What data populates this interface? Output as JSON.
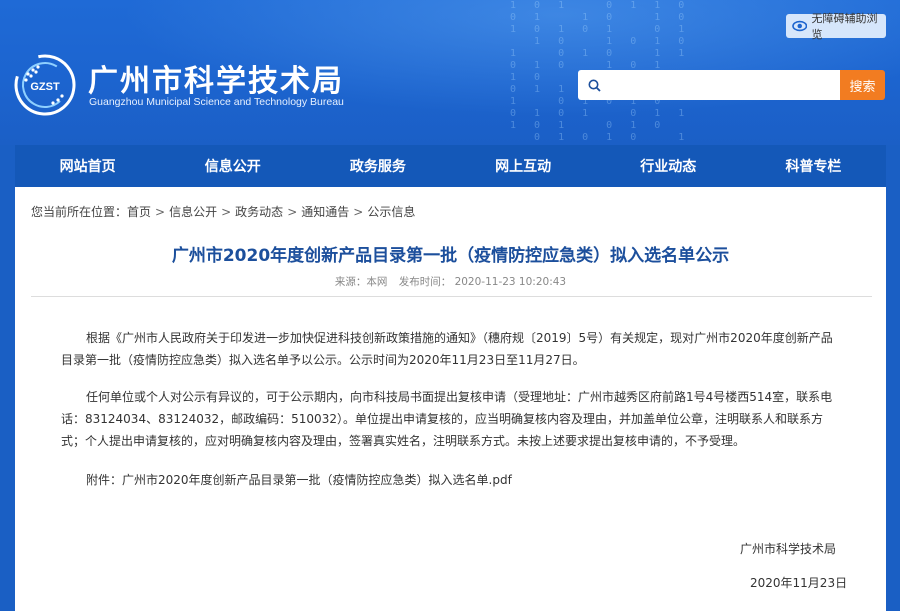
{
  "header": {
    "title": "广州市科学技术局",
    "subtitle": "Guangzhou Municipal Science and Technology Bureau",
    "logo_text": "GZST",
    "accessibility_label": "无障碍辅助浏览",
    "search_placeholder": "",
    "search_button": "搜索"
  },
  "nav": {
    "items": [
      {
        "label": "网站首页"
      },
      {
        "label": "信息公开"
      },
      {
        "label": "政务服务"
      },
      {
        "label": "网上互动"
      },
      {
        "label": "行业动态"
      },
      {
        "label": "科普专栏"
      }
    ]
  },
  "breadcrumb": {
    "prefix": "您当前所在位置：",
    "items": [
      "首页",
      "信息公开",
      "政务动态",
      "通知通告",
      "公示信息"
    ],
    "separator": ">"
  },
  "article": {
    "title": "广州市2020年度创新产品目录第一批（疫情防控应急类）拟入选名单公示",
    "source": "来源：本网",
    "time": "发布时间：  2020-11-23 10:20:43",
    "paragraphs": [
      "根据《广州市人民政府关于印发进一步加快促进科技创新政策措施的通知》（穗府规〔2019〕5号）有关规定，现对广州市2020年度创新产品目录第一批（疫情防控应急类）拟入选名单予以公示。公示时间为2020年11月23日至11月27日。",
      "任何单位或个人对公示有异议的，可于公示期内，向市科技局书面提出复核申请（受理地址：广州市越秀区府前路1号4号楼西514室，联系电话：83124034、83124032，邮政编码：510032）。单位提出申请复核的，应当明确复核内容及理由，并加盖单位公章，注明联系人和联系方式；个人提出申请复核的，应对明确复核内容及理由，签署真实姓名，注明联系方式。未按上述要求提出复核申请的，不予受理。",
      "附件：广州市2020年度创新产品目录第一批（疫情防控应急类）拟入选名单.pdf"
    ],
    "signature_org": "广州市科学技术局",
    "signature_date": "2020年11月23日"
  },
  "colors": {
    "banner": "#1c64cf",
    "nav": "#1458b8",
    "title": "#1c4f9c",
    "search_button": "#f27c21"
  },
  "icons": {
    "accessibility": "eye-icon",
    "search": "search-icon",
    "logo": "gzst-logo"
  }
}
